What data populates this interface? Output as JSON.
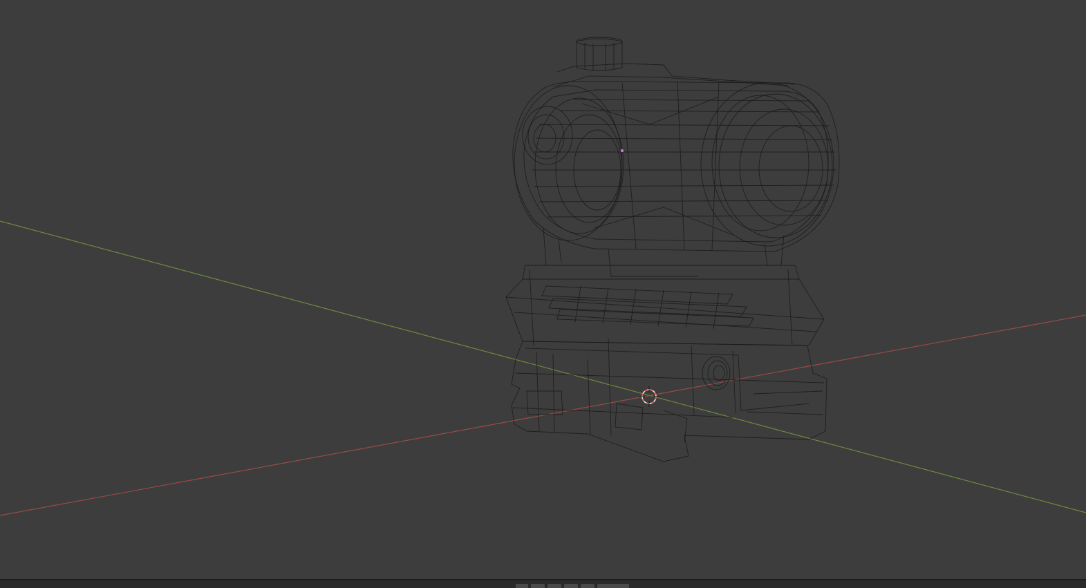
{
  "viewport": {
    "shading": "wireframe",
    "object": "red-dot-sight",
    "colors": {
      "background": "#3d3d3d",
      "x_axis": "#9a4a4a",
      "y_axis": "#6f8a3e",
      "wire": "#1c1c1c",
      "cursor_red": "#e05a5a",
      "cursor_white": "#f0f0f0",
      "origin": "#c678dd"
    }
  },
  "statusbar": {
    "tabs": [
      "",
      "",
      "",
      "",
      "",
      ""
    ]
  }
}
